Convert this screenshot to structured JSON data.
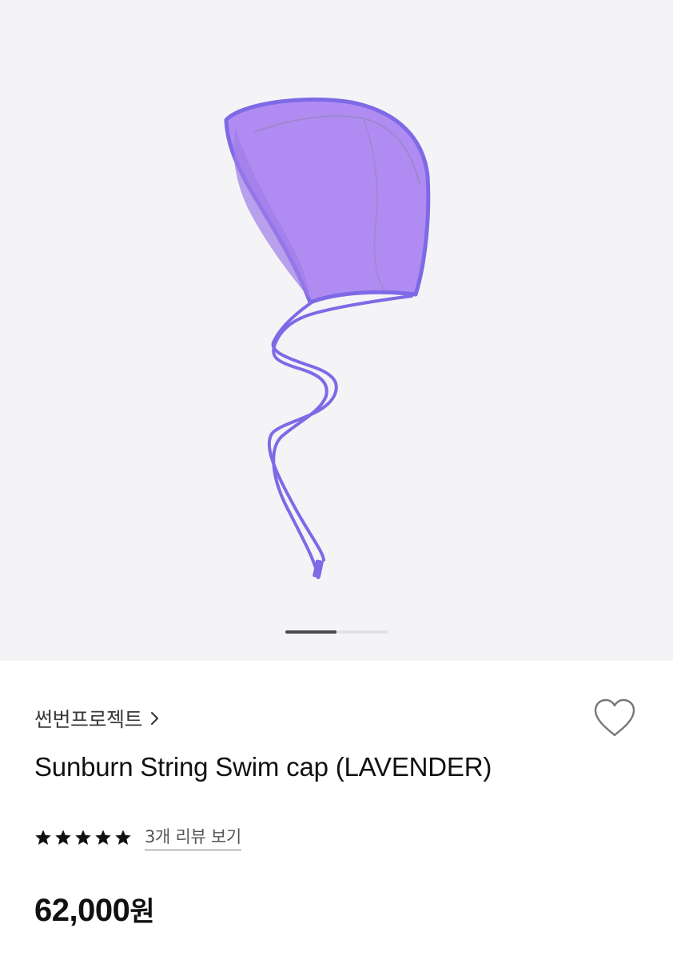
{
  "gallery": {
    "image_alt": "Sunburn String Swim cap (LAVENDER)",
    "current_slide": 1,
    "slide_count": 2
  },
  "product": {
    "brand": "썬번프로젝트",
    "title": "Sunburn String Swim cap (LAVENDER)",
    "rating": 5,
    "review_link": "3개 리뷰 보기",
    "price_amount": "62,000",
    "price_currency": "원"
  },
  "colors": {
    "cap_fill": "#b08cf2",
    "cap_trim": "#7e6ae6",
    "background": "#f4f4f6"
  },
  "icons": {
    "brand_link": "chevron-right-icon",
    "wishlist": "heart-outline-icon",
    "rating": "star-icon"
  }
}
